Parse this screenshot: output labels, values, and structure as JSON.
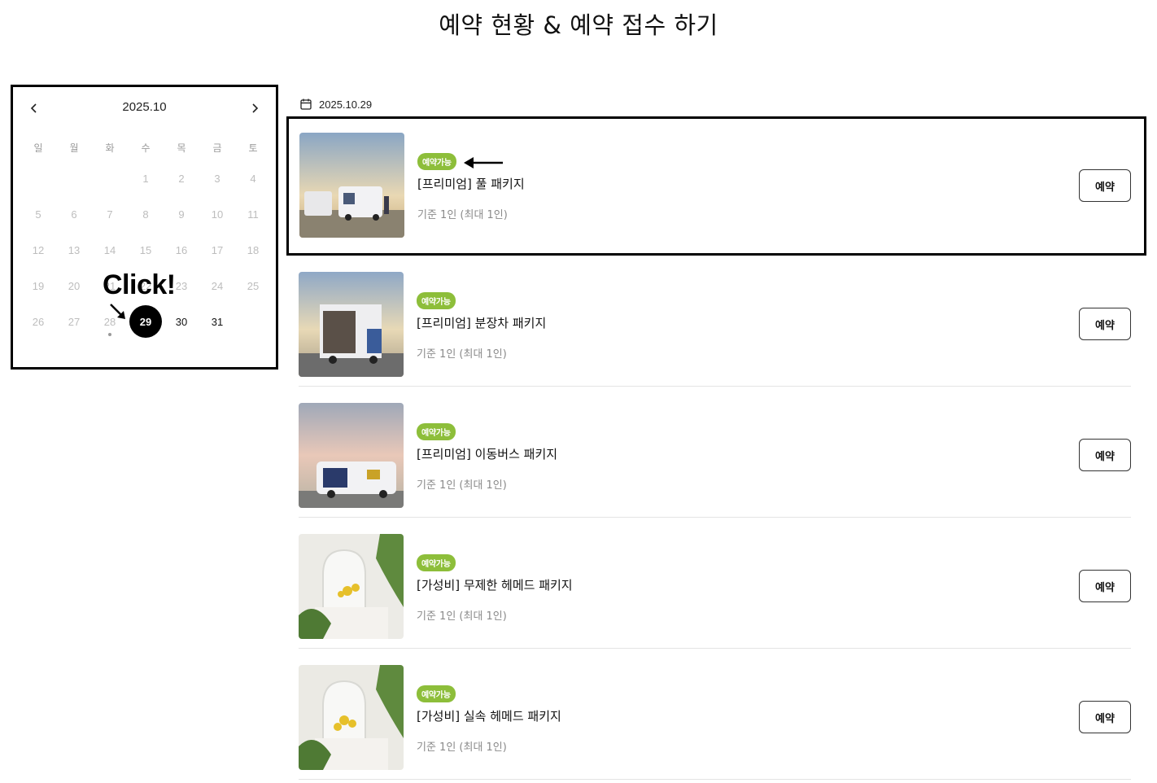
{
  "page": {
    "title": "예약 현황 & 예약 접수 하기"
  },
  "calendar": {
    "month_label": "2025.10",
    "prev_icon": "chevron-left-icon",
    "next_icon": "chevron-right-icon",
    "weekdays": [
      "일",
      "월",
      "화",
      "수",
      "목",
      "금",
      "토"
    ],
    "weeks": [
      [
        "",
        "",
        "",
        "1",
        "2",
        "3",
        "4"
      ],
      [
        "5",
        "6",
        "7",
        "8",
        "9",
        "10",
        "11"
      ],
      [
        "12",
        "13",
        "14",
        "15",
        "16",
        "17",
        "18"
      ],
      [
        "19",
        "20",
        "21",
        "22",
        "23",
        "24",
        "25"
      ],
      [
        "26",
        "27",
        "28",
        "29",
        "30",
        "31",
        ""
      ]
    ],
    "selected_day": "29",
    "available_days": [
      "29",
      "30",
      "31"
    ],
    "marked_days": [
      "28"
    ]
  },
  "annotation": {
    "click_text": "Click!"
  },
  "selected_date": {
    "icon": "calendar-icon",
    "label": "2025.10.29"
  },
  "products": [
    {
      "badge": "예약가능",
      "name": "[프리미엄] 풀 패키지",
      "meta": "기준 1인 (최대 1인)",
      "button": "예약"
    },
    {
      "badge": "예약가능",
      "name": "[프리미엄] 분장차 패키지",
      "meta": "기준 1인 (최대 1인)",
      "button": "예약"
    },
    {
      "badge": "예약가능",
      "name": "[프리미엄] 이동버스 패키지",
      "meta": "기준 1인 (최대 1인)",
      "button": "예약"
    },
    {
      "badge": "예약가능",
      "name": "[가성비] 무제한 헤메드 패키지",
      "meta": "기준 1인 (최대 1인)",
      "button": "예약"
    },
    {
      "badge": "예약가능",
      "name": "[가성비] 실속 헤메드 패키지",
      "meta": "기준 1인 (최대 1인)",
      "button": "예약"
    }
  ],
  "colors": {
    "badge": "#8dbe3a",
    "selected_day_bg": "#000000"
  }
}
